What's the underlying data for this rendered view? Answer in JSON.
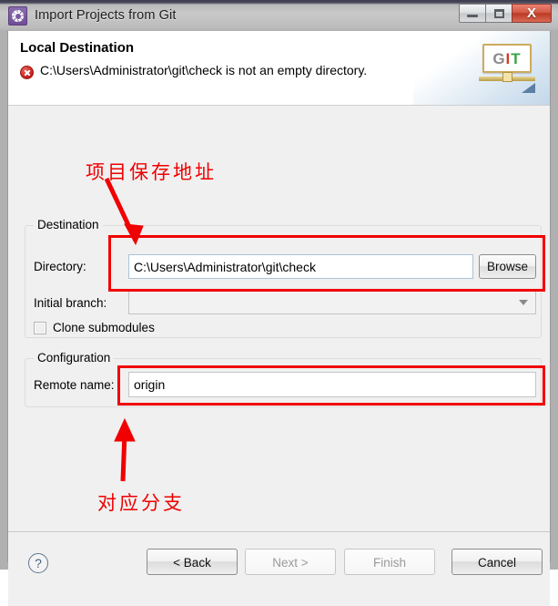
{
  "window": {
    "title": "Import Projects from Git",
    "icon": "gear-icon",
    "controls": {
      "minimize": "–",
      "maximize": "□",
      "close": "X"
    }
  },
  "header": {
    "title": "Local Destination",
    "error_icon": "error-circle-icon",
    "error_message": "C:\\Users\\Administrator\\git\\check is not an empty directory.",
    "logo": {
      "g": "G",
      "i": "I",
      "t": "T"
    }
  },
  "destination": {
    "group_title": "Destination",
    "directory_label": "Directory:",
    "directory_value": "C:\\Users\\Administrator\\git\\check",
    "browse_label": "Browse",
    "initial_branch_label": "Initial branch:",
    "initial_branch_value": "",
    "clone_submodules_label": "Clone submodules",
    "clone_submodules_checked": false
  },
  "configuration": {
    "group_title": "Configuration",
    "remote_name_label": "Remote name:",
    "remote_name_value": "origin"
  },
  "annotations": {
    "accent_color": "#f00000",
    "top_note": "项目保存地址",
    "bottom_note": "对应分支"
  },
  "footer": {
    "help_icon": "question-mark-icon",
    "buttons": [
      {
        "label": "< Back",
        "enabled": true
      },
      {
        "label": "Next >",
        "enabled": false
      },
      {
        "label": "Finish",
        "enabled": false
      },
      {
        "label": "Cancel",
        "enabled": true
      }
    ]
  }
}
